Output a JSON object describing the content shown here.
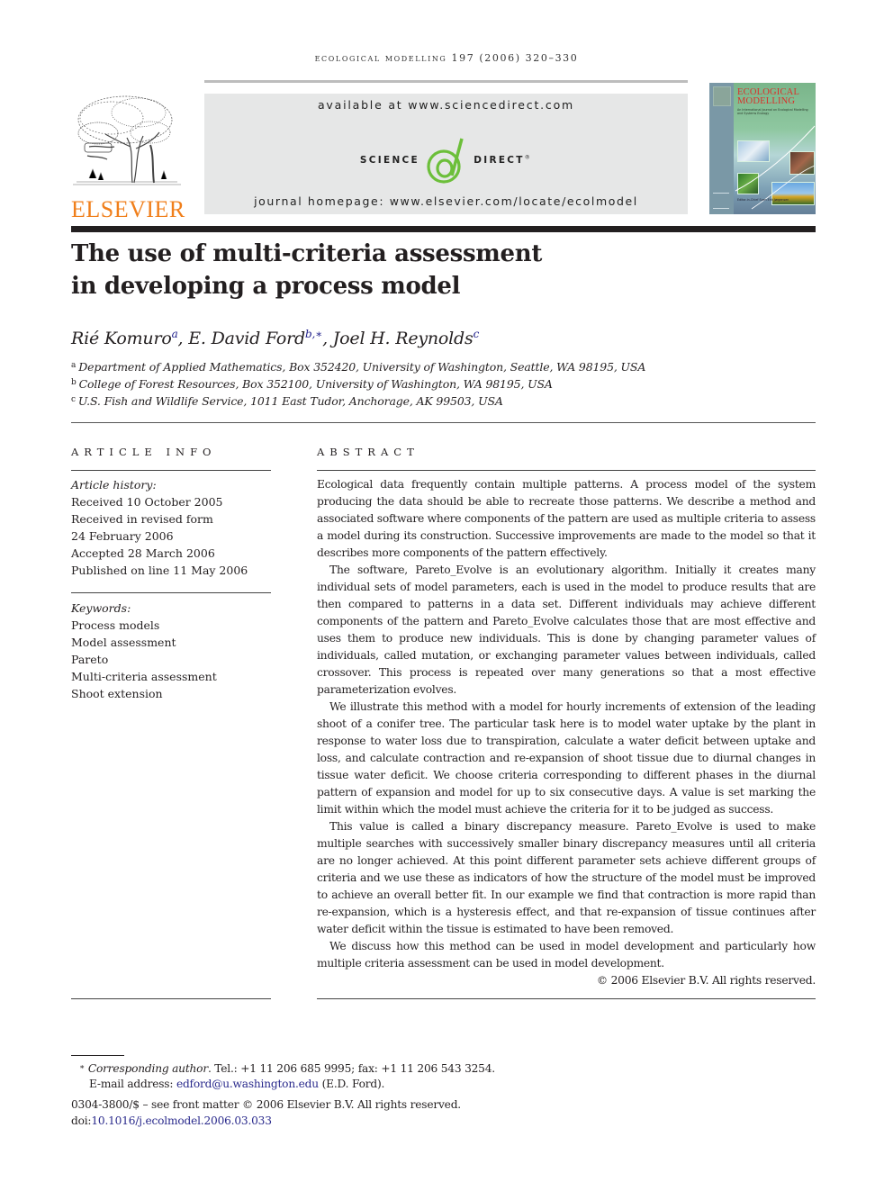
{
  "running_header": "ecological modelling 197 (2006) 320–330",
  "masthead": {
    "publisher": "ELSEVIER",
    "available_at": "available at www.sciencedirect.com",
    "sciencedirect_left": "SCIENCE",
    "sciencedirect_at": "@",
    "sciencedirect_right": "DIRECT",
    "sciencedirect_reg": "®",
    "homepage": "journal homepage: www.elsevier.com/locate/ecolmodel",
    "cover": {
      "title_line1": "ECOLOGICAL",
      "title_line2": "MODELLING",
      "subtitle": "An International Journal on Ecological Modelling and Systems Ecology",
      "editor": "Editor-in-Chief Sven Erik Jørgensen"
    },
    "colors": {
      "elsevier_orange": "#f07f1b",
      "sd_green": "#6cbf3a",
      "link_blue": "#2a2a8c",
      "banner_gray": "#e6e7e7"
    }
  },
  "title": {
    "line1": "The use of multi-criteria assessment",
    "line2": "in developing a process model"
  },
  "authors": [
    {
      "name": "Rié Komuro",
      "marks": "a"
    },
    {
      "name": "E. David Ford",
      "marks": "b,∗"
    },
    {
      "name": "Joel H. Reynolds",
      "marks": "c"
    }
  ],
  "author_separator": ", ",
  "affiliations": [
    {
      "mark": "a",
      "text": "Department of Applied Mathematics, Box 352420, University of Washington, Seattle, WA 98195, USA"
    },
    {
      "mark": "b",
      "text": "College of Forest Resources, Box 352100, University of Washington, WA 98195, USA"
    },
    {
      "mark": "c",
      "text": "U.S. Fish and Wildlife Service, 1011 East Tudor, Anchorage, AK 99503, USA"
    }
  ],
  "article_info": {
    "heading": "ARTICLE INFO",
    "history_label": "Article history:",
    "history": [
      "Received 10 October 2005",
      "Received in revised form",
      "24 February 2006",
      "Accepted 28 March 2006",
      "Published on line 11 May 2006"
    ],
    "keywords_label": "Keywords:",
    "keywords": [
      "Process models",
      "Model assessment",
      "Pareto",
      "Multi-criteria assessment",
      "Shoot extension"
    ]
  },
  "abstract": {
    "heading": "ABSTRACT",
    "paragraphs": [
      "Ecological data frequently contain multiple patterns. A process model of the system producing the data should be able to recreate those patterns. We describe a method and associated software where components of the pattern are used as multiple criteria to assess a model during its construction. Successive improvements are made to the model so that it describes more components of the pattern effectively.",
      "The software, Pareto_Evolve is an evolutionary algorithm. Initially it creates many individual sets of model parameters, each is used in the model to produce results that are then compared to patterns in a data set. Different individuals may achieve different components of the pattern and Pareto_Evolve calculates those that are most effective and uses them to produce new individuals. This is done by changing parameter values of individuals, called mutation, or exchanging parameter values between individuals, called crossover. This process is repeated over many generations so that a most effective parameterization evolves.",
      "We illustrate this method with a model for hourly increments of extension of the leading shoot of a conifer tree. The particular task here is to model water uptake by the plant in response to water loss due to transpiration, calculate a water deficit between uptake and loss, and calculate contraction and re-expansion of shoot tissue due to diurnal changes in tissue water deficit. We choose criteria corresponding to different phases in the diurnal pattern of expansion and model for up to six consecutive days. A value is set marking the limit within which the model must achieve the criteria for it to be judged as success.",
      "This value is called a binary discrepancy measure. Pareto_Evolve is used to make multiple searches with successively smaller binary discrepancy measures until all criteria are no longer achieved. At this point different parameter sets achieve different groups of criteria and we use these as indicators of how the structure of the model must be improved to achieve an overall better fit. In our example we find that contraction is more rapid than re-expansion, which is a hysteresis effect, and that re-expansion of tissue continues after water deficit within the tissue is estimated to have been removed.",
      "We discuss how this method can be used in model development and particularly how multiple criteria assessment can be used in model development."
    ],
    "copyright": "© 2006 Elsevier B.V. All rights reserved."
  },
  "footnote": {
    "mark": "∗",
    "label": "Corresponding author",
    "contact": ". Tel.: +1 11 206 685 9995; fax: +1 11 206 543 3254.",
    "email_label": "E-mail address: ",
    "email": "edford@u.washington.edu",
    "email_suffix": " (E.D. Ford)."
  },
  "front_matter": "0304-3800/$ – see front matter © 2006 Elsevier B.V. All rights reserved.",
  "doi_label": "doi:",
  "doi": "10.1016/j.ecolmodel.2006.03.033"
}
